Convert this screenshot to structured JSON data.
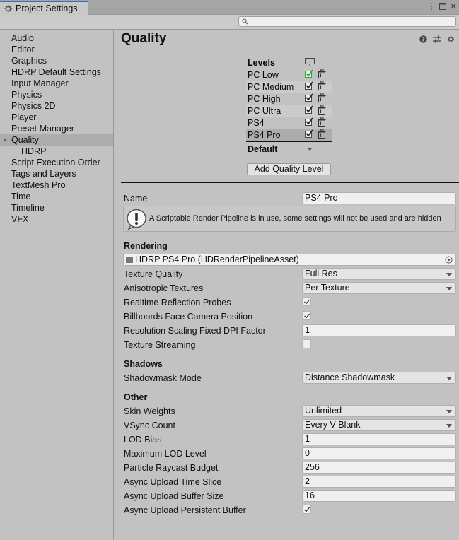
{
  "window": {
    "tab_title": "Project Settings",
    "controls": [
      "menu-icon",
      "maximize-icon",
      "close-icon"
    ]
  },
  "search": {
    "placeholder": "",
    "value": ""
  },
  "sidebar": {
    "items": [
      {
        "label": "Audio"
      },
      {
        "label": "Editor"
      },
      {
        "label": "Graphics"
      },
      {
        "label": "HDRP Default Settings"
      },
      {
        "label": "Input Manager"
      },
      {
        "label": "Physics"
      },
      {
        "label": "Physics 2D"
      },
      {
        "label": "Player"
      },
      {
        "label": "Preset Manager"
      },
      {
        "label": "Quality",
        "selected": true,
        "expanded": true
      },
      {
        "label": "HDRP",
        "child": true
      },
      {
        "label": "Script Execution Order"
      },
      {
        "label": "Tags and Layers"
      },
      {
        "label": "TextMesh Pro"
      },
      {
        "label": "Time"
      },
      {
        "label": "Timeline"
      },
      {
        "label": "VFX"
      }
    ]
  },
  "main": {
    "title": "Quality",
    "header_icons": [
      "help-icon",
      "presets-icon",
      "settings-icon"
    ],
    "levels": {
      "heading": "Levels",
      "column_icon": "monitor-icon",
      "rows": [
        {
          "name": "PC Low",
          "enabled": true,
          "is_default_platform": true
        },
        {
          "name": "PC Medium",
          "enabled": true
        },
        {
          "name": "PC High",
          "enabled": true
        },
        {
          "name": "PC Ultra",
          "enabled": true
        },
        {
          "name": "PS4",
          "enabled": true
        },
        {
          "name": "PS4 Pro",
          "enabled": true,
          "selected": true
        }
      ],
      "default_label": "Default"
    },
    "add_button": "Add Quality Level",
    "name_label": "Name",
    "name_value": "PS4 Pro",
    "help_message": "A Scriptable Render Pipeline is in use, some settings will not be used and are hidden",
    "rendering": {
      "heading": "Rendering",
      "pipeline_asset": "HDRP PS4 Pro (HDRenderPipelineAsset)",
      "texture_quality": {
        "label": "Texture Quality",
        "value": "Full Res"
      },
      "anisotropic": {
        "label": "Anisotropic Textures",
        "value": "Per Texture"
      },
      "realtime_reflection": {
        "label": "Realtime Reflection Probes",
        "checked": true
      },
      "billboards": {
        "label": "Billboards Face Camera Position",
        "checked": true
      },
      "dpi_factor": {
        "label": "Resolution Scaling Fixed DPI Factor",
        "value": "1"
      },
      "texture_streaming": {
        "label": "Texture Streaming",
        "checked": false
      }
    },
    "shadows": {
      "heading": "Shadows",
      "shadowmask": {
        "label": "Shadowmask Mode",
        "value": "Distance Shadowmask"
      }
    },
    "other": {
      "heading": "Other",
      "skin_weights": {
        "label": "Skin Weights",
        "value": "Unlimited"
      },
      "vsync": {
        "label": "VSync Count",
        "value": "Every V Blank"
      },
      "lod_bias": {
        "label": "LOD Bias",
        "value": "1"
      },
      "max_lod": {
        "label": "Maximum LOD Level",
        "value": "0"
      },
      "raycast_budget": {
        "label": "Particle Raycast Budget",
        "value": "256"
      },
      "time_slice": {
        "label": "Async Upload Time Slice",
        "value": "2"
      },
      "buffer_size": {
        "label": "Async Upload Buffer Size",
        "value": "16"
      },
      "persistent_buffer": {
        "label": "Async Upload Persistent Buffer",
        "checked": true
      }
    }
  }
}
